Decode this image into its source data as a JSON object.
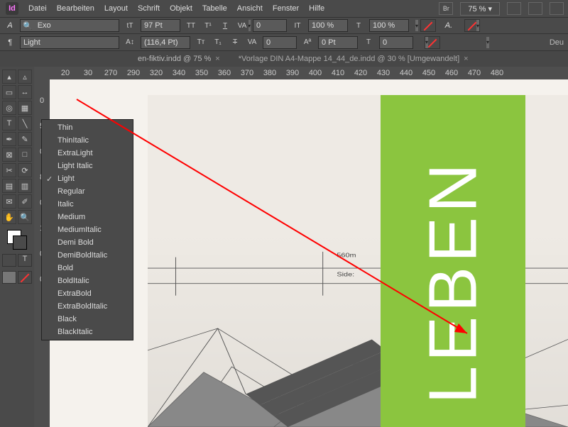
{
  "menu": {
    "items": [
      "Datei",
      "Bearbeiten",
      "Layout",
      "Schrift",
      "Objekt",
      "Tabelle",
      "Ansicht",
      "Fenster",
      "Hilfe"
    ],
    "zoom": "75 %"
  },
  "ctrl1": {
    "font_search": "Exo",
    "size": "97 Pt",
    "hscale": "100 %",
    "vscale": "100 %",
    "kern": "0"
  },
  "ctrl2": {
    "style": "Light",
    "leading": "(116,4 Pt)",
    "tracking": "0",
    "shift": "0 Pt",
    "lang": "Deu",
    "kern2": "0"
  },
  "tabs": {
    "t1": "en-fiktiv.indd @ 75 %",
    "t2": "*Vorlage DIN A4-Mappe 14_44_de.indd @ 30 % [Umgewandelt]"
  },
  "ruler_h": [
    "20",
    "30",
    "270",
    "290",
    "320",
    "340",
    "350",
    "360",
    "370",
    "380",
    "390",
    "400",
    "410",
    "420",
    "430",
    "440",
    "450",
    "460",
    "470",
    "480"
  ],
  "ruler_v": [
    "0",
    "5",
    "0",
    "8",
    "0",
    "1",
    "0",
    "0"
  ],
  "dropdown": {
    "items": [
      "Thin",
      "ThinItalic",
      "ExtraLight",
      "Light Italic",
      "Light",
      "Regular",
      "Italic",
      "Medium",
      "MediumItalic",
      "Demi Bold",
      "DemiBoldItalic",
      "Bold",
      "BoldItalic",
      "ExtraBold",
      "ExtraBoldItalic",
      "Black",
      "BlackItalic"
    ],
    "checked": "Light"
  },
  "greentext": "LEBEN",
  "sketch_labels": {
    "a": "560m",
    "b": "Side:"
  }
}
